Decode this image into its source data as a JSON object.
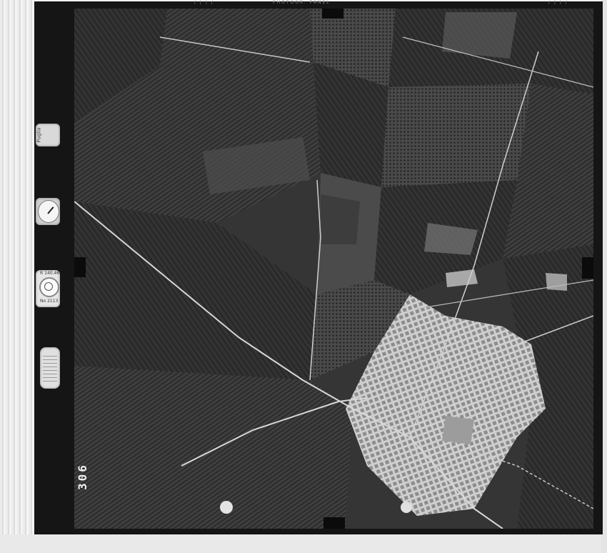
{
  "film": {
    "frame_number": "306",
    "instrument_label": "Puglia",
    "level_readout_top": "R 140.46",
    "level_readout_bottom": "No 2113",
    "top_marks_left": "/ | | /",
    "top_marks_center": "PHOTOGR. PANEL",
    "top_marks_right": "/ | | /"
  },
  "colors": {
    "film_border": "#151515",
    "field_dark": "#2c2c2c",
    "field_light": "#5a5a5a",
    "town": "#d6d6d6",
    "road": "#dcdcdc"
  }
}
